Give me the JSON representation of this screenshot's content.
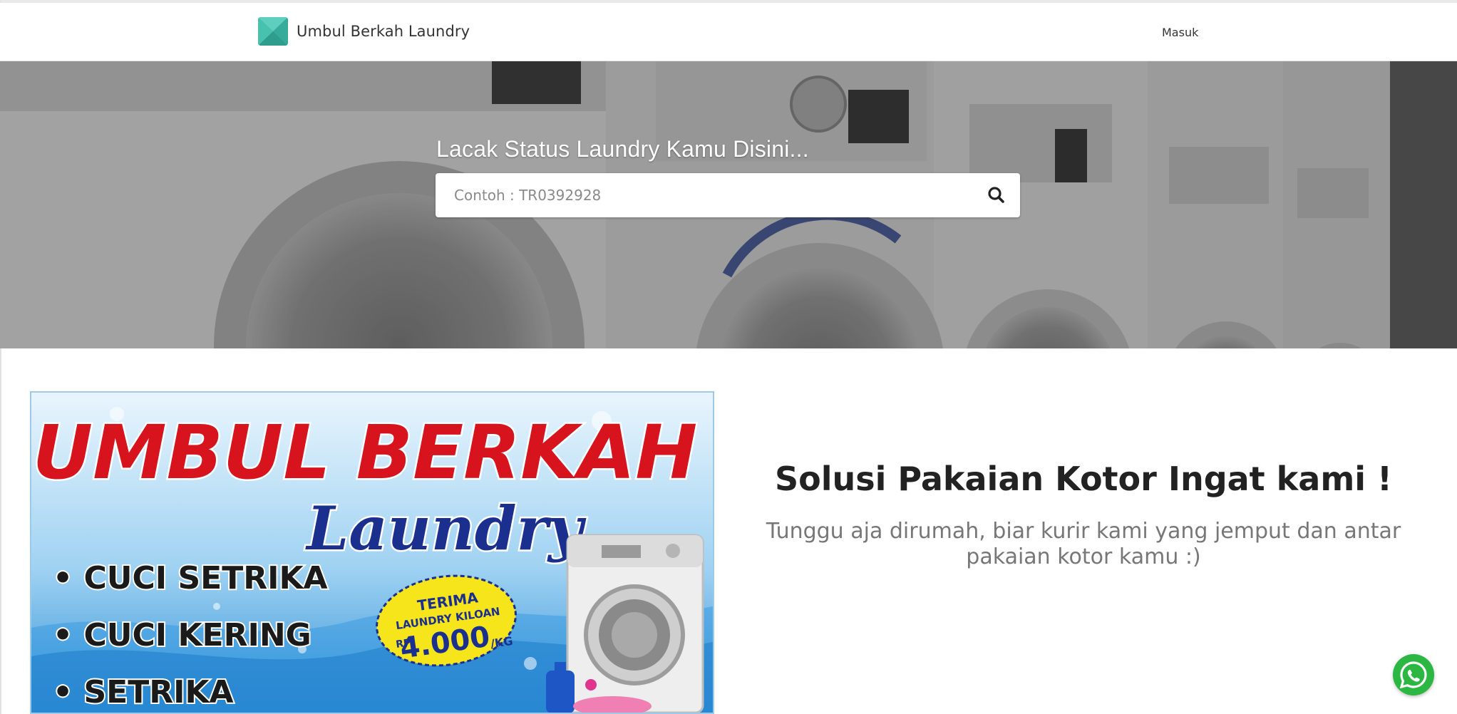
{
  "navbar": {
    "brand_name": "Umbul Berkah Laundry",
    "brand_icon": "laundry-logo-icon",
    "login_label": "Masuk"
  },
  "hero": {
    "title": "Lacak Status Laundry Kamu Disini...",
    "search_placeholder": "Contoh : TR0392928",
    "search_value": "",
    "search_icon": "search-icon"
  },
  "promo_banner": {
    "title_line1": "UMBUL BERKAH",
    "title_line2": "Laundry",
    "services": [
      "• CUCI SETRIKA",
      "• CUCI KERING",
      "• SETRIKA"
    ],
    "badge_line1": "TERIMA",
    "badge_line2": "LAUNDRY KILOAN",
    "badge_currency": "RP",
    "badge_price": "4.000",
    "badge_unit": "/KG"
  },
  "content": {
    "headline": "Solusi Pakaian Kotor Ingat kami !",
    "subtext": "Tunggu aja dirumah, biar kurir kami yang jemput dan antar pakaian kotor kamu :)"
  },
  "floating": {
    "whatsapp_icon": "whatsapp-icon"
  },
  "colors": {
    "brand_teal": "#3fb8a6",
    "hero_overlay": "#6f6f6f",
    "banner_red": "#d7141d",
    "banner_blue": "#1b2f8f",
    "badge_yellow": "#f7e51b",
    "whatsapp_green": "#2bb741"
  }
}
